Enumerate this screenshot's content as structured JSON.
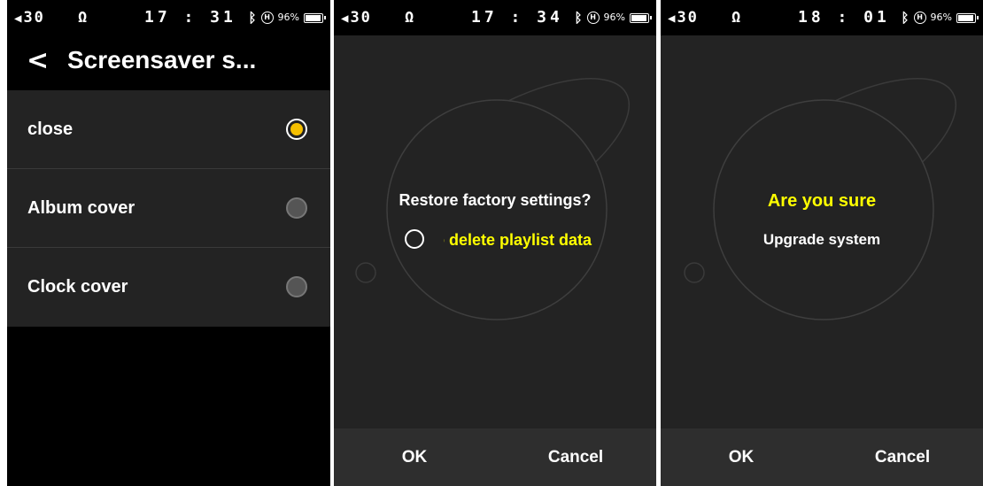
{
  "status_bars": [
    {
      "volume": "30",
      "time": "17 : 31",
      "battery": "96%",
      "battery_level": 0.96
    },
    {
      "volume": "30",
      "time": "17 : 34",
      "battery": "96%",
      "battery_level": 0.96
    },
    {
      "volume": "30",
      "time": "18 : 01",
      "battery": "96%",
      "battery_level": 0.96
    }
  ],
  "status_icons": {
    "speaker": "speaker-icon",
    "headphones": "headphones-icon",
    "bluetooth": "bluetooth-icon",
    "hifi": "H"
  },
  "screensaver": {
    "title": "Screensaver s...",
    "options": [
      {
        "label": "close",
        "selected": true
      },
      {
        "label": "Album cover",
        "selected": false
      },
      {
        "label": "Clock cover",
        "selected": false
      }
    ]
  },
  "restore_dialog": {
    "question": "Restore factory settings?",
    "option_text": "o delete playlist data",
    "ok": "OK",
    "cancel": "Cancel"
  },
  "upgrade_dialog": {
    "confirm": "Are you sure",
    "subtitle": "Upgrade system",
    "ok": "OK",
    "cancel": "Cancel"
  },
  "colors": {
    "accent": "#f6c000",
    "highlight_text": "#ffff00",
    "background": "#232323"
  }
}
